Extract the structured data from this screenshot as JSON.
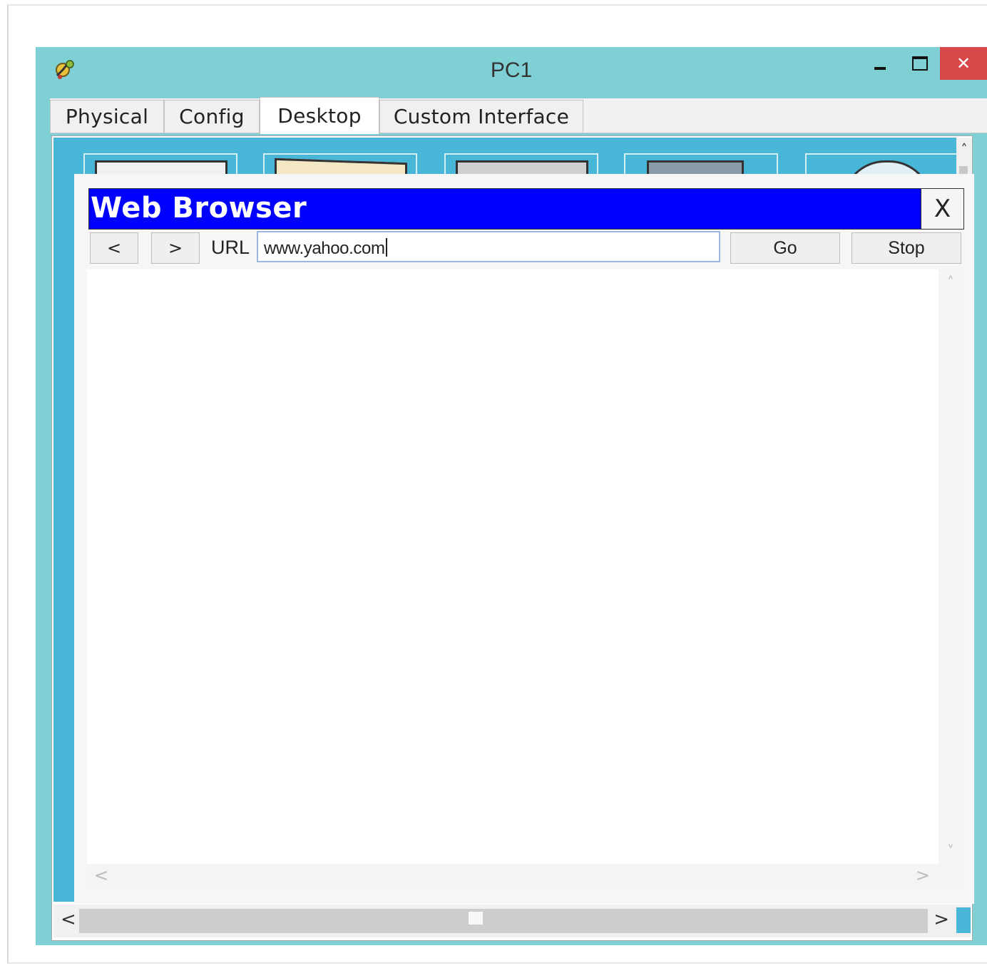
{
  "window": {
    "title": "PC1",
    "minimize": "",
    "maximize": "",
    "close": "✕"
  },
  "tabs": [
    {
      "label": "Physical"
    },
    {
      "label": "Config"
    },
    {
      "label": "Desktop",
      "active": true
    },
    {
      "label": "Custom Interface"
    }
  ],
  "browser": {
    "title": "Web Browser",
    "close_label": "X",
    "back_label": "<",
    "forward_label": ">",
    "url_label": "URL",
    "url_value": "www.yahoo.com",
    "go_label": "Go",
    "stop_label": "Stop"
  },
  "colors": {
    "window_bg": "#7fd0d4",
    "desktop_bg": "#48b6d6",
    "browser_titlebar": "#0000ff",
    "close_red": "#d8474a"
  }
}
